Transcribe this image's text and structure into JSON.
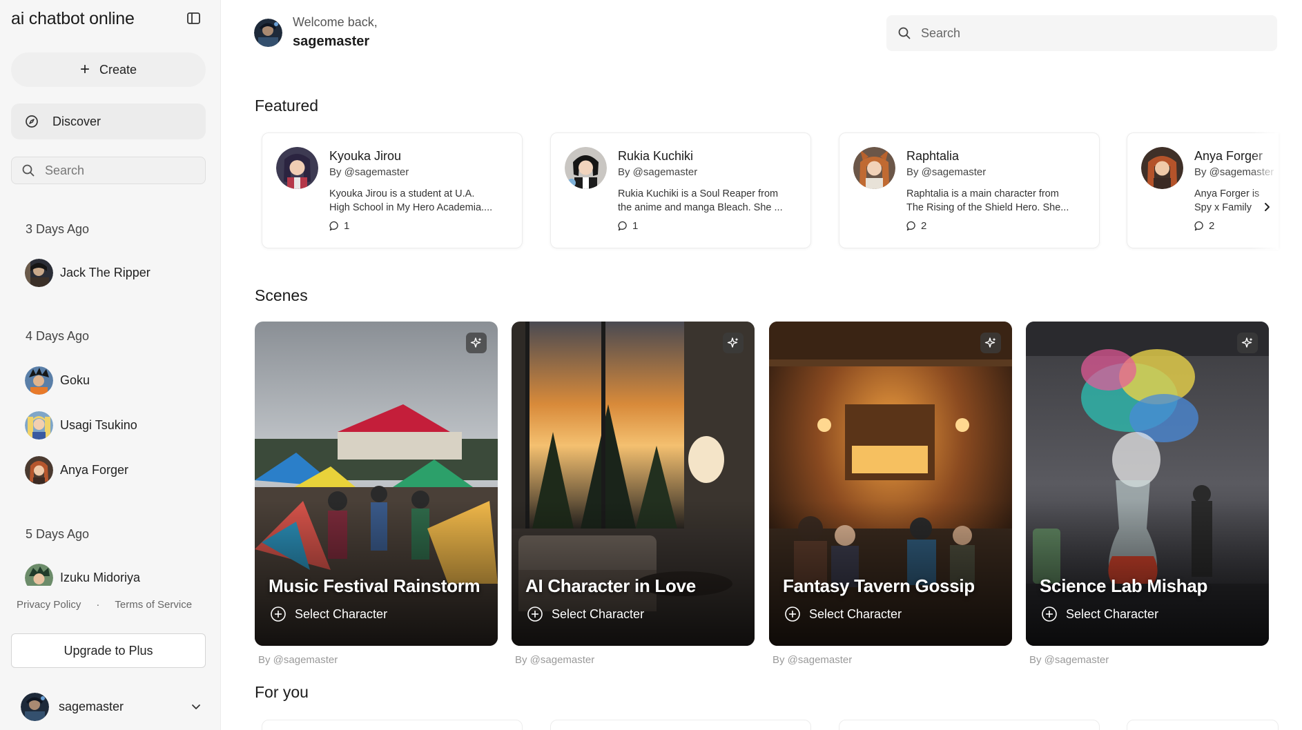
{
  "sidebar": {
    "brand": "ai chatbot online",
    "create_label": "Create",
    "discover_label": "Discover",
    "search_placeholder": "Search",
    "groups": [
      {
        "label": "3 Days Ago",
        "items": [
          {
            "name": "Jack The Ripper"
          }
        ]
      },
      {
        "label": "4 Days Ago",
        "items": [
          {
            "name": "Goku"
          },
          {
            "name": "Usagi Tsukino"
          },
          {
            "name": "Anya Forger"
          }
        ]
      },
      {
        "label": "5 Days Ago",
        "items": [
          {
            "name": "Izuku Midoriya"
          }
        ]
      }
    ],
    "privacy_label": "Privacy Policy",
    "separator": "·",
    "terms_label": "Terms of Service",
    "upgrade_label": "Upgrade to Plus",
    "username": "sagemaster"
  },
  "header": {
    "welcome": "Welcome back,",
    "username": "sagemaster",
    "search_placeholder": "Search"
  },
  "featured": {
    "title": "Featured",
    "cards": [
      {
        "name": "Kyouka Jirou",
        "by": "By @sagemaster",
        "desc_line1": "Kyouka Jirou is a student at U.A.",
        "desc_line2": "High School in My Hero Academia....",
        "count": "1"
      },
      {
        "name": "Rukia Kuchiki",
        "by": "By @sagemaster",
        "desc_line1": "Rukia Kuchiki is a Soul Reaper from",
        "desc_line2": "the anime and manga Bleach. She ...",
        "count": "1"
      },
      {
        "name": "Raphtalia",
        "by": "By @sagemaster",
        "desc_line1": "Raphtalia is a main character from",
        "desc_line2": "The Rising of the Shield Hero. She...",
        "count": "2"
      },
      {
        "name": "Anya Forger",
        "by": "By @sagemaster",
        "desc_line1": "Anya Forger is",
        "desc_line2": "Spy x Family",
        "count": "2"
      }
    ]
  },
  "scenes": {
    "title": "Scenes",
    "select_label": "Select Character",
    "cards": [
      {
        "title": "Music Festival Rainstorm",
        "by": "By @sagemaster"
      },
      {
        "title": "AI Character in Love",
        "by": "By @sagemaster"
      },
      {
        "title": "Fantasy Tavern Gossip",
        "by": "By @sagemaster"
      },
      {
        "title": "Science Lab Mishap",
        "by": "By @sagemaster"
      }
    ]
  },
  "for_you": {
    "title": "For you"
  },
  "colors": {
    "sidebar_bg": "#f6f6f6",
    "text": "#1b1b1b",
    "muted": "#999999",
    "card_border": "#ececec"
  },
  "icons": [
    "sidebar-toggle-icon",
    "plus-icon",
    "compass-icon",
    "search-icon",
    "chevron-down-icon",
    "comment-icon",
    "chevron-right-icon",
    "sparkle-icon",
    "plus-circle-icon"
  ]
}
